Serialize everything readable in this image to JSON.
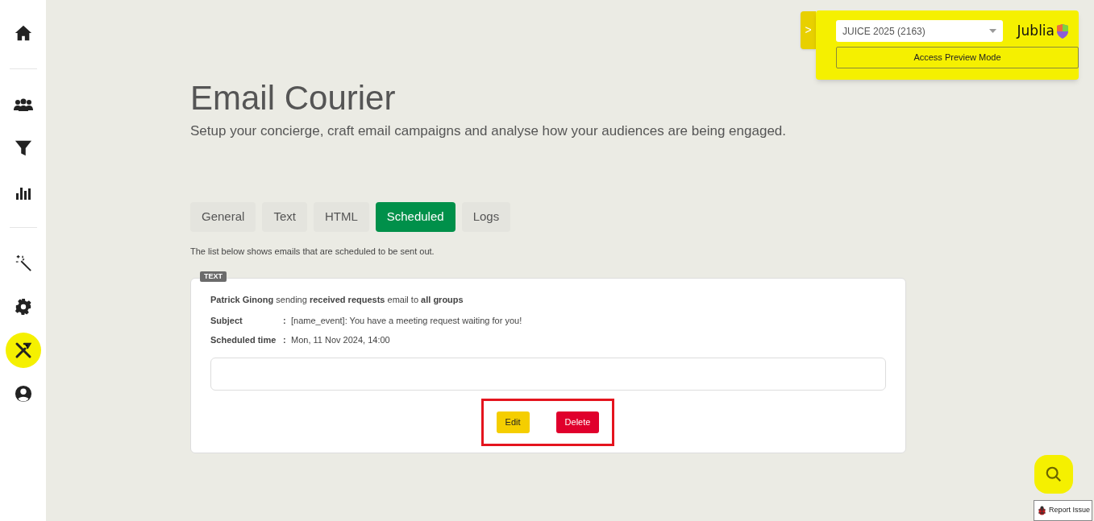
{
  "sidebar": {
    "items": [
      {
        "kind": "home",
        "selected": false
      },
      {
        "kind": "divider"
      },
      {
        "kind": "people",
        "selected": false
      },
      {
        "kind": "funnel",
        "selected": false
      },
      {
        "kind": "chart",
        "selected": false
      },
      {
        "kind": "divider"
      },
      {
        "kind": "wand",
        "selected": false
      },
      {
        "kind": "gear",
        "selected": false
      },
      {
        "kind": "tools",
        "selected": true
      },
      {
        "kind": "user",
        "selected": false
      }
    ]
  },
  "header": {
    "title": "Email Courier",
    "subtitle": "Setup your concierge, craft email campaigns and analyse how your audiences are being engaged."
  },
  "tabs": [
    {
      "label": "General",
      "selected": false
    },
    {
      "label": "Text",
      "selected": false
    },
    {
      "label": "HTML",
      "selected": false
    },
    {
      "label": "Scheduled",
      "selected": true
    },
    {
      "label": "Logs",
      "selected": false
    }
  ],
  "intro": "The list below shows emails that are scheduled to be sent out.",
  "scheduled": [
    {
      "badge": "TEXT",
      "summary": "**Patrick Ginong** sending **received requests** email to **all groups**",
      "fields": [
        {
          "label": "Subject",
          "separator": ":",
          "value": "[name_event]: You have a meeting request waiting for you!"
        },
        {
          "label": "Scheduled time",
          "separator": ":",
          "value": "Mon, 11 Nov 2024, 14:00"
        }
      ],
      "actions": [
        {
          "label": "Edit",
          "kind": "edit"
        },
        {
          "label": "Delete",
          "kind": "delete"
        }
      ],
      "highlighted": true
    }
  ],
  "event_panel": {
    "toggle": ">",
    "event": "JUICE 2025 (2163)",
    "logo": "Jublia",
    "preview_button": "Access Preview Mode"
  },
  "report_issue": "Report Issue"
}
